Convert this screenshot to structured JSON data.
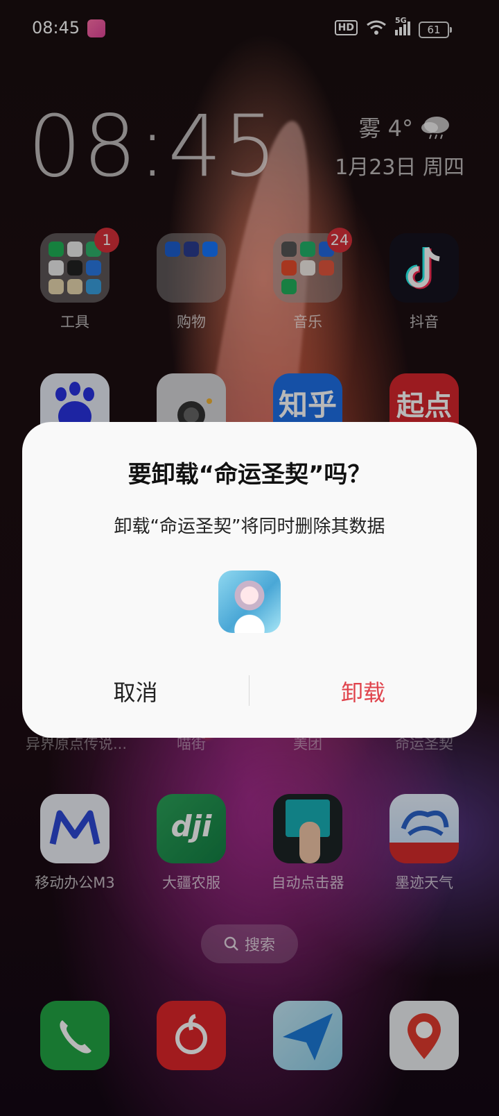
{
  "status_bar": {
    "time": "08:45",
    "network": "5G",
    "battery": "61",
    "hd_label": "HD"
  },
  "clock_widget": {
    "time": "08:45",
    "weather": "雾 4°",
    "date": "1月23日 周四"
  },
  "apps_row1": [
    {
      "label": "工具",
      "badge": "1"
    },
    {
      "label": "购物"
    },
    {
      "label": "音乐",
      "badge": "24"
    },
    {
      "label": "抖音"
    }
  ],
  "apps_row2_partial": {
    "zhihu_text": "知乎",
    "qidian_text": "起点"
  },
  "apps_row3_labels": [
    "异界原点传说...",
    "喵街",
    "美团",
    "命运圣契"
  ],
  "apps_row4": [
    {
      "label": "移动办公M3"
    },
    {
      "label": "大疆农服"
    },
    {
      "label": "自动点击器"
    },
    {
      "label": "墨迹天气"
    }
  ],
  "search": {
    "label": "搜索"
  },
  "dialog": {
    "title": "要卸载“命运圣契”吗？",
    "message": "卸载“命运圣契”将同时删除其数据",
    "cancel_label": "取消",
    "uninstall_label": "卸载"
  },
  "colors": {
    "danger": "#e0434c",
    "badge": "#d9303a"
  }
}
